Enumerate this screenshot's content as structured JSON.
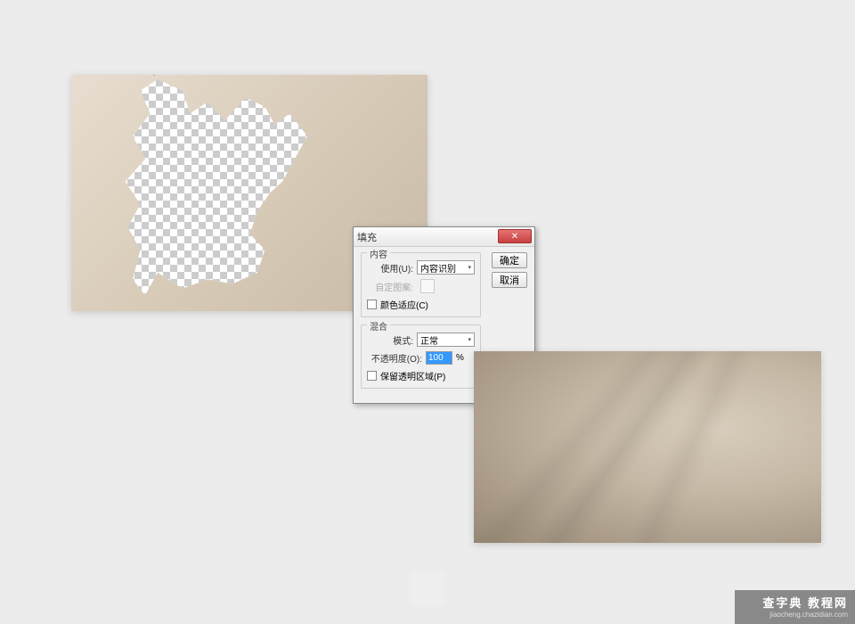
{
  "dialog": {
    "title": "填充",
    "close_glyph": "✕",
    "ok_label": "确定",
    "cancel_label": "取消",
    "content_group": {
      "title": "内容",
      "use_label": "使用(U):",
      "use_value": "内容识别",
      "pattern_label": "自定图案:",
      "color_adapt_label": "颜色适应(C)"
    },
    "blend_group": {
      "title": "混合",
      "mode_label": "模式:",
      "mode_value": "正常",
      "opacity_label": "不透明度(O):",
      "opacity_value": "100",
      "opacity_unit": "%",
      "preserve_label": "保留透明区域(P)"
    }
  },
  "watermark": {
    "main": "查字典 教程网",
    "sub": "jiaocheng.chazidian.com"
  }
}
